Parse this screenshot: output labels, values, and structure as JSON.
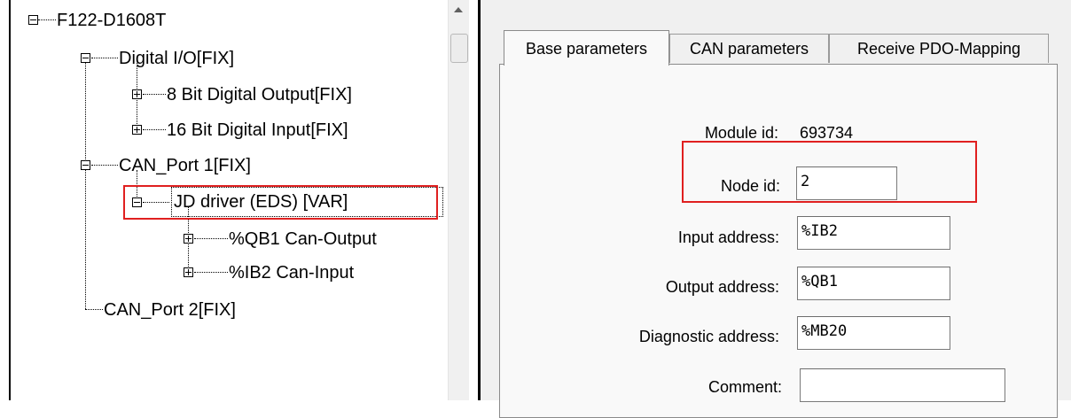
{
  "tree": {
    "root": {
      "label": "F122-D1608T",
      "toggle": "minus"
    },
    "digital_io": {
      "label": "Digital I/O[FIX]",
      "toggle": "minus"
    },
    "digital_output": {
      "label": "8 Bit Digital Output[FIX]",
      "toggle": "plus"
    },
    "digital_input": {
      "label": "16 Bit Digital Input[FIX]",
      "toggle": "plus"
    },
    "can_port1": {
      "label": "CAN_Port 1[FIX]",
      "toggle": "minus"
    },
    "jd_driver": {
      "label": "JD driver (EDS)  [VAR]",
      "toggle": "minus",
      "selected": true
    },
    "can_output": {
      "label": "%QB1 Can-Output",
      "toggle": "plus"
    },
    "can_input": {
      "label": "%IB2 Can-Input",
      "toggle": "plus"
    },
    "can_port2": {
      "label": "CAN_Port 2[FIX]"
    }
  },
  "tabs": [
    {
      "label": "Base parameters",
      "active": true
    },
    {
      "label": "CAN parameters",
      "active": false
    },
    {
      "label": "Receive PDO-Mapping",
      "active": false
    }
  ],
  "form": {
    "module_id": {
      "label": "Module id:",
      "value": "693734"
    },
    "node_id": {
      "label": "Node id:",
      "value": "2"
    },
    "input_address": {
      "label": "Input address:",
      "value": "%IB2"
    },
    "output_address": {
      "label": "Output address:",
      "value": "%QB1"
    },
    "diagnostic_address": {
      "label": "Diagnostic address:",
      "value": "%MB20"
    },
    "comment": {
      "label": "Comment:",
      "value": ""
    }
  },
  "colors": {
    "highlight_box": "#e02020",
    "panel_background": "#f0f0f0"
  }
}
